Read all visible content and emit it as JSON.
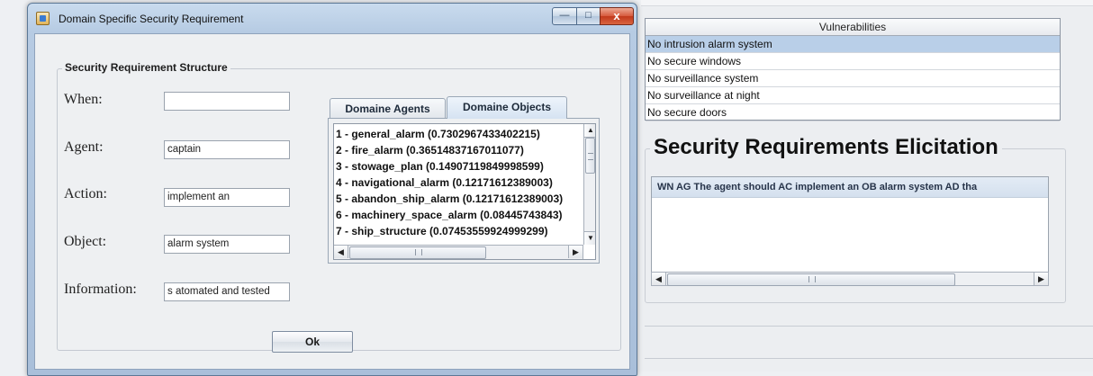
{
  "dialog": {
    "title": "Domain Specific Security Requirement",
    "controls": {
      "minimize": "—",
      "maximize": "□",
      "close": "x"
    },
    "legend": "Security Requirement Structure",
    "fields": [
      {
        "label": "When:",
        "value": ""
      },
      {
        "label": "Agent:",
        "value": "captain"
      },
      {
        "label": "Action:",
        "value": "implement an"
      },
      {
        "label": "Object:",
        "value": "alarm system"
      },
      {
        "label": "Information:",
        "value": "s atomated and tested"
      }
    ],
    "tabs": [
      {
        "label": "Domaine Agents",
        "active": false
      },
      {
        "label": "Domaine Objects",
        "active": true
      }
    ],
    "objects_list": [
      "1 - general_alarm (0.7302967433402215)",
      "2 - fire_alarm (0.36514837167011077)",
      "3 - stowage_plan (0.14907119849998599)",
      "4 - navigational_alarm (0.12171612389003)",
      "5 - abandon_ship_alarm (0.12171612389003)",
      "6 - machinery_space_alarm (0.08445743843)",
      "7 - ship_structure (0.07453559924999299)"
    ],
    "ok_label": "Ok"
  },
  "vulnerabilities": {
    "header": "Vulnerabilities",
    "rows": [
      {
        "text": "No intrusion alarm system",
        "selected": true
      },
      {
        "text": "No secure windows",
        "selected": false
      },
      {
        "text": "No surveillance system",
        "selected": false
      },
      {
        "text": "No surveillance at night",
        "selected": false
      },
      {
        "text": "No secure doors",
        "selected": false
      }
    ]
  },
  "elicitation": {
    "title": "Security Requirements Elicitation",
    "line": "WN  AG The agent should AC implement an OB alarm system AD tha"
  },
  "icons": {
    "app": "java-app-icon",
    "scroll_left": "◀",
    "scroll_right": "▶",
    "scroll_up": "▲",
    "scroll_down": "▼"
  },
  "colors": {
    "selected_row": "#b9cfe8",
    "title_bar": "#b6cbe3",
    "close_button": "#c2391c"
  }
}
